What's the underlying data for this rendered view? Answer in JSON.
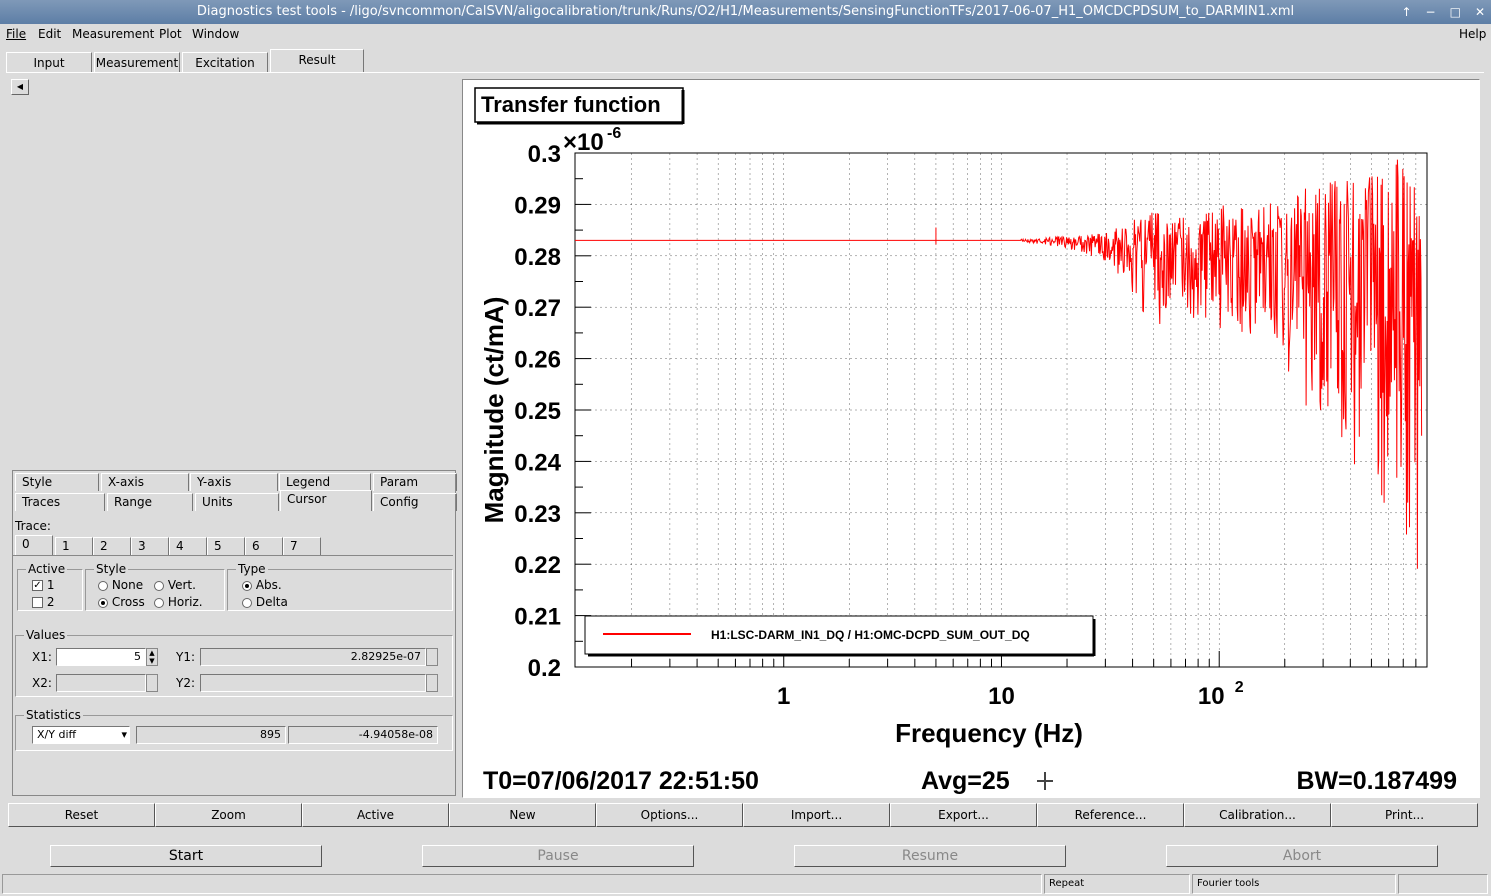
{
  "window": {
    "title": "Diagnostics test tools - /ligo/svncommon/CalSVN/aligocalibration/trunk/Runs/O2/H1/Measurements/SensingFunctionTFs/2017-06-07_H1_OMCDCPDSUM_to_DARMIN1.xml"
  },
  "menu": {
    "file": "File",
    "edit": "Edit",
    "measurement": "Measurement",
    "plot": "Plot",
    "window": "Window",
    "help": "Help"
  },
  "main_tabs": [
    "Input",
    "Measurement",
    "Excitation",
    "Result"
  ],
  "settings_tabs_row1": [
    "Style",
    "X-axis",
    "Y-axis",
    "Legend",
    "Param"
  ],
  "settings_tabs_row2": [
    "Traces",
    "Range",
    "Units",
    "Cursor",
    "Config"
  ],
  "cursor": {
    "trace_label": "Trace:",
    "trace_tabs": [
      "0",
      "1",
      "2",
      "3",
      "4",
      "5",
      "6",
      "7"
    ],
    "active_label": "Active",
    "active_1": "1",
    "active_2": "2",
    "style_label": "Style",
    "style_none": "None",
    "style_vert": "Vert.",
    "style_cross": "Cross",
    "style_horiz": "Horiz.",
    "type_label": "Type",
    "type_abs": "Abs.",
    "type_delta": "Delta",
    "values_label": "Values",
    "x1_label": "X1:",
    "x1_value": "5",
    "y1_label": "Y1:",
    "y1_value": "2.82925e-07",
    "x2_label": "X2:",
    "y2_label": "Y2:",
    "statistics_label": "Statistics",
    "stat_select": "X/Y diff",
    "stat_value1": "895",
    "stat_value2": "-4.94058e-08"
  },
  "plot": {
    "title": "Transfer function",
    "footer_t0": "T0=07/06/2017 22:51:50",
    "footer_avg": "Avg=25",
    "footer_bw": "BW=0.187499"
  },
  "chart_data": {
    "type": "line",
    "title": "Transfer function",
    "xlabel": "Frequency (Hz)",
    "ylabel": "Magnitude (ct/mA)",
    "x_scale": "log",
    "xlim": [
      0.11,
      900
    ],
    "ylim": [
      0.2,
      0.3
    ],
    "y_multiplier": "×10",
    "y_multiplier_exp": "-6",
    "x_tick_labels": [
      "1",
      "10",
      "10",
      "2"
    ],
    "y_tick_labels": [
      "0.2",
      "0.21",
      "0.22",
      "0.23",
      "0.24",
      "0.25",
      "0.26",
      "0.27",
      "0.28",
      "0.29",
      "0.3"
    ],
    "grid": true,
    "legend_position": "bottom-left",
    "series": [
      {
        "name": "H1:LSC-DARM_IN1_DQ / H1:OMC-DCPD_SUM_OUT_DQ",
        "color": "#ff0000",
        "x": [
          0.11,
          5,
          12,
          20,
          30,
          50,
          70,
          100,
          150,
          200,
          300,
          500,
          700,
          850
        ],
        "y": [
          0.283,
          0.283,
          0.283,
          0.2828,
          0.2825,
          0.282,
          0.281,
          0.28,
          0.279,
          0.278,
          0.274,
          0.272,
          0.27,
          0.266
        ],
        "band_min": [
          0.283,
          0.283,
          0.2828,
          0.2815,
          0.279,
          0.2655,
          0.268,
          0.266,
          0.262,
          0.258,
          0.242,
          0.236,
          0.224,
          0.217
        ],
        "band_max": [
          0.283,
          0.283,
          0.2832,
          0.2838,
          0.2845,
          0.289,
          0.288,
          0.29,
          0.289,
          0.293,
          0.294,
          0.297,
          0.3,
          0.29
        ]
      }
    ]
  },
  "toolbar": [
    "Reset",
    "Zoom",
    "Active",
    "New",
    "Options...",
    "Import...",
    "Export...",
    "Reference...",
    "Calibration...",
    "Print..."
  ],
  "controls": {
    "start": "Start",
    "pause": "Pause",
    "resume": "Resume",
    "abort": "Abort"
  },
  "status": {
    "repeat": "Repeat",
    "fourier": "Fourier tools"
  }
}
